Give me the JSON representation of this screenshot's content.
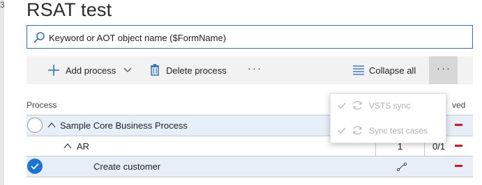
{
  "window": {
    "edge_glyph": "3"
  },
  "page": {
    "title": "RSAT test"
  },
  "search": {
    "placeholder": "Keyword or AOT object name ($FormName)"
  },
  "toolbar": {
    "add_process_label": "Add process",
    "delete_process_label": "Delete process",
    "more_label": "···",
    "collapse_all_label": "Collapse all",
    "overflow_label": "···"
  },
  "columns": {
    "process": "Process",
    "right_partial": "ved"
  },
  "rows": [
    {
      "label": "Sample Core Business Process",
      "level": 0,
      "expanded": true,
      "selected": false
    },
    {
      "label": "AR",
      "level": 1,
      "expanded": true,
      "count": "1",
      "ratio": "0/1"
    },
    {
      "label": "Create customer",
      "level": 2,
      "selected": true
    }
  ],
  "menu": {
    "items": [
      {
        "label": "VSTS sync",
        "icon": "sync-icon",
        "enabled": false
      },
      {
        "label": "Sync test cases",
        "icon": "sync-icon",
        "enabled": false
      }
    ]
  },
  "colors": {
    "accent": "#1a73d6",
    "status_red": "#e3101a",
    "row_highlight": "#e6eef8"
  }
}
